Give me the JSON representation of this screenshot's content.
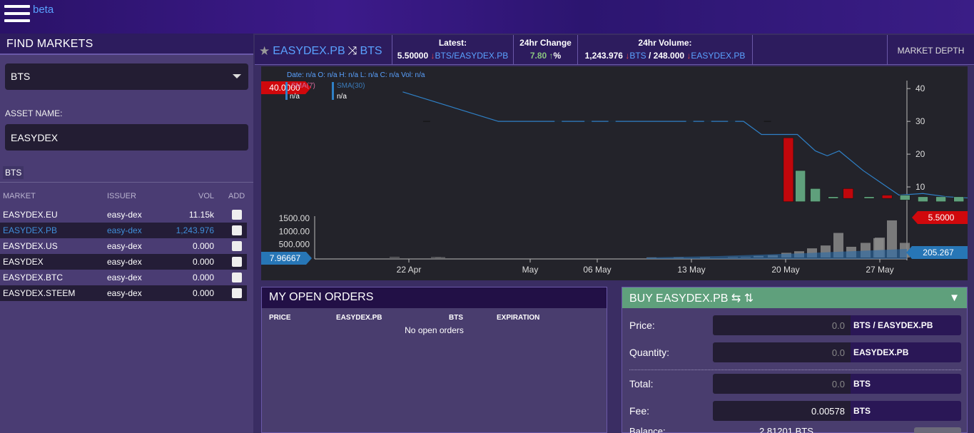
{
  "app": {
    "beta_label": "beta"
  },
  "sidebar": {
    "title": "FIND MARKETS",
    "base_select": "BTS",
    "asset_label": "ASSET NAME:",
    "asset_value": "EASYDEX",
    "chip": "BTS",
    "columns": {
      "market": "MARKET",
      "issuer": "ISSUER",
      "vol": "VOL",
      "add": "ADD"
    },
    "rows": [
      {
        "market": "EASYDEX.EU",
        "issuer": "easy-dex",
        "vol": "11.15k"
      },
      {
        "market": "EASYDEX.PB",
        "issuer": "easy-dex",
        "vol": "1,243.976"
      },
      {
        "market": "EASYDEX.US",
        "issuer": "easy-dex",
        "vol": "0.000"
      },
      {
        "market": "EASYDEX",
        "issuer": "easy-dex",
        "vol": "0.000"
      },
      {
        "market": "EASYDEX.BTC",
        "issuer": "easy-dex",
        "vol": "0.000"
      },
      {
        "market": "EASYDEX.STEEM",
        "issuer": "easy-dex",
        "vol": "0.000"
      }
    ]
  },
  "market": {
    "quote": "EASYDEX.PB",
    "base": "BTS",
    "latest_label": "Latest:",
    "latest_value": "5.50000",
    "latest_pair": "BTS/EASYDEX.PB",
    "change_label": "24hr Change",
    "change_value": "7.80",
    "change_unit": "%",
    "volume_label": "24hr Volume:",
    "volume_bts": "1,243.976",
    "volume_bts_unit": "BTS",
    "volume_quote": "/ 248.000",
    "volume_quote_unit": "EASYDEX.PB",
    "market_depth": "MARKET DEPTH",
    "arrow_down": "↓",
    "arrow_up": "↑"
  },
  "chart_data": {
    "type": "candlestick",
    "info": "Date: n/a O: n/a H: n/a L: n/a C: n/a Vol: n/a",
    "sma7_label": "SMA(7)",
    "sma30_label": "SMA(30)",
    "sma7_value": "n/a",
    "sma30_value": "n/a",
    "price_axis_ticks": [
      "40",
      "30",
      "20",
      "10"
    ],
    "volume_axis_ticks": [
      "1500.00",
      "1000.00",
      "500.000"
    ],
    "x_ticks": [
      "22 Apr",
      "May",
      "06 May",
      "13 May",
      "20 May",
      "27 May"
    ],
    "max_price_tag": "40.0000",
    "current_price_tag": "5.5000",
    "volume_left_tag": "7.96667",
    "volume_right_tag": "205.267",
    "ylim": [
      0,
      42
    ],
    "candles": [
      {
        "x": 0.35,
        "o": 30,
        "c": 30
      },
      {
        "x": 0.57,
        "o": 30,
        "c": 30
      },
      {
        "x": 0.62,
        "o": 30,
        "c": 30
      },
      {
        "x": 0.66,
        "o": 30,
        "c": 30
      },
      {
        "x": 0.79,
        "o": 30,
        "c": 30
      },
      {
        "x": 0.82,
        "o": 30,
        "c": 30
      },
      {
        "x": 0.86,
        "o": 30,
        "c": 30
      },
      {
        "x": 0.92,
        "o": 30,
        "c": 30
      },
      {
        "x": 0.955,
        "o": 25,
        "c": 5.5
      },
      {
        "x": 0.975,
        "o": 5.5,
        "c": 15
      },
      {
        "x": 1.0,
        "o": 5.5,
        "c": 9.5
      },
      {
        "x": 1.03,
        "o": 6.5,
        "c": 7.0
      },
      {
        "x": 1.055,
        "o": 9.5,
        "c": 6.5
      },
      {
        "x": 1.09,
        "o": 6.5,
        "c": 7.0
      },
      {
        "x": 1.12,
        "o": 7.5,
        "c": 6.5
      },
      {
        "x": 1.15,
        "o": 6.0,
        "c": 7.5
      },
      {
        "x": 1.18,
        "o": 5.5,
        "c": 7.0
      },
      {
        "x": 1.21,
        "o": 5.5,
        "c": 7.0
      },
      {
        "x": 1.24,
        "o": 5.5,
        "c": 7.0
      },
      {
        "x": 1.27,
        "o": 5.5,
        "c": 7.5
      },
      {
        "x": 1.3,
        "o": 7.0,
        "c": 5.5
      }
    ],
    "sma_line": [
      {
        "x": 0.31,
        "y": 39
      },
      {
        "x": 0.47,
        "y": 30
      },
      {
        "x": 0.88,
        "y": 30
      },
      {
        "x": 0.91,
        "y": 26
      },
      {
        "x": 0.97,
        "y": 26
      },
      {
        "x": 1.0,
        "y": 21
      },
      {
        "x": 1.02,
        "y": 19.5
      },
      {
        "x": 1.04,
        "y": 21
      },
      {
        "x": 1.08,
        "y": 15
      },
      {
        "x": 1.14,
        "y": 7.5
      },
      {
        "x": 1.18,
        "y": 8
      },
      {
        "x": 1.22,
        "y": 7
      },
      {
        "x": 1.27,
        "y": 6.5
      },
      {
        "x": 1.3,
        "y": 6
      }
    ],
    "volumes": [
      20,
      15,
      10,
      5,
      10,
      10,
      20,
      25,
      60,
      90,
      180,
      240,
      350,
      460,
      940,
      410,
      560,
      740,
      760,
      1420,
      560
    ]
  },
  "orders": {
    "title": "MY OPEN ORDERS",
    "col_price": "PRICE",
    "col_quote": "EASYDEX.PB",
    "col_base": "BTS",
    "col_exp": "EXPIRATION",
    "empty": "No open orders"
  },
  "buy": {
    "title": "BUY EASYDEX.PB ⇆ ⇅",
    "toggle": "▼",
    "price_label": "Price:",
    "price_value": "0.0",
    "price_unit": "BTS / EASYDEX.PB",
    "qty_label": "Quantity:",
    "qty_value": "0.0",
    "qty_unit": "EASYDEX.PB",
    "total_label": "Total:",
    "total_value": "0.0",
    "total_unit": "BTS",
    "fee_label": "Fee:",
    "fee_value": "0.00578",
    "fee_unit": "BTS",
    "balance_label": "Balance:",
    "balance_value": "2.81201 BTS"
  }
}
